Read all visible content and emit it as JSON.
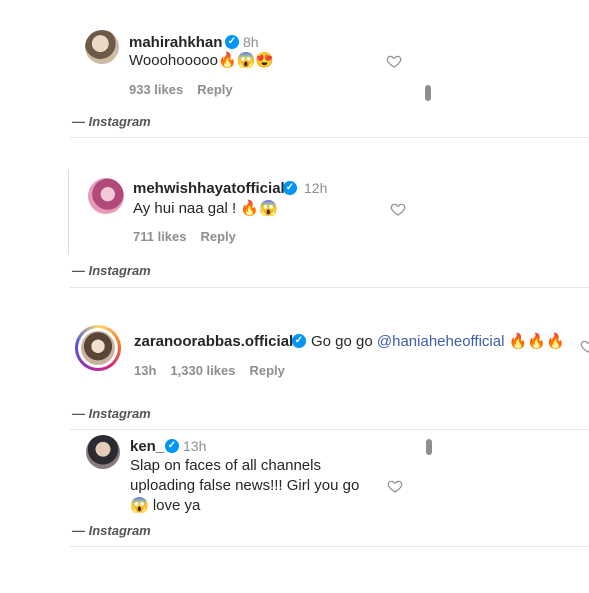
{
  "comments": [
    {
      "username": "mahirahkhan",
      "time": "8h",
      "text": "Wooohooooo🔥😱😍",
      "likes": "933 likes",
      "reply": "Reply",
      "source": "— Instagram"
    },
    {
      "username": "mehwishhayatofficial",
      "time": "12h",
      "text": "Ay hui naa gal ! 🔥😱",
      "likes": "711 likes",
      "reply": "Reply",
      "source": "— Instagram"
    },
    {
      "username": "zaranoorabbas.official",
      "text_prefix": "Go go go",
      "mention": "@haniaheheofficial",
      "text_suffix": "🔥🔥🔥",
      "time": "13h",
      "likes": "1,330 likes",
      "reply": "Reply",
      "source": "— Instagram"
    },
    {
      "username": "ken_",
      "time": "13h",
      "text_line1": "Slap on faces of all channels",
      "text_line2": "uploading false news!!! Girl you go",
      "text_line3": "😱 love ya",
      "source": "— Instagram"
    }
  ],
  "icons": {
    "verified": "verified-badge-icon",
    "heart": "heart-outline-icon"
  },
  "colors": {
    "verified": "#0095f6",
    "mention": "#3b5ea8",
    "muted": "#8e8e8e"
  }
}
